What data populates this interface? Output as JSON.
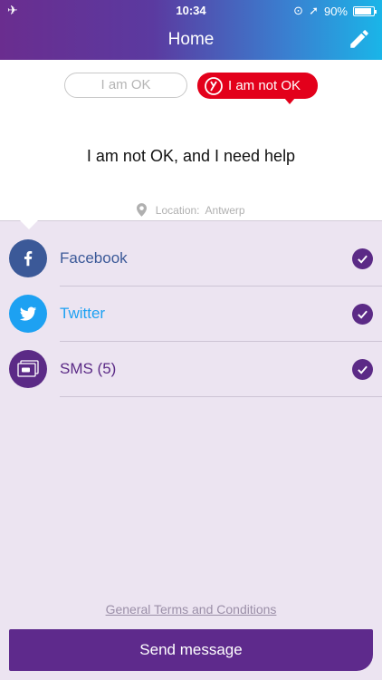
{
  "status_bar": {
    "time": "10:34",
    "battery": "90%",
    "battery_level": 0.9
  },
  "header": {
    "title": "Home"
  },
  "toggles": {
    "ok_label": "I am OK",
    "not_ok_label": "I am not OK",
    "selected": "not_ok"
  },
  "message": "I am not OK, and I need help",
  "location": {
    "label": "Location:",
    "city": "Antwerp"
  },
  "channels": [
    {
      "label": "Facebook",
      "checked": true,
      "color": "#3b5998",
      "icon": "facebook-icon"
    },
    {
      "label": "Twitter",
      "checked": true,
      "color": "#1da1f2",
      "icon": "twitter-icon"
    },
    {
      "label": "SMS (5)",
      "checked": true,
      "color": "#5b2a86",
      "icon": "sms-icon"
    }
  ],
  "footer": {
    "terms_label": "General Terms and Conditions",
    "send_label": "Send message"
  },
  "colors": {
    "accent": "#5e2a8c",
    "alert": "#e3001b",
    "background": "#ece4f1"
  }
}
